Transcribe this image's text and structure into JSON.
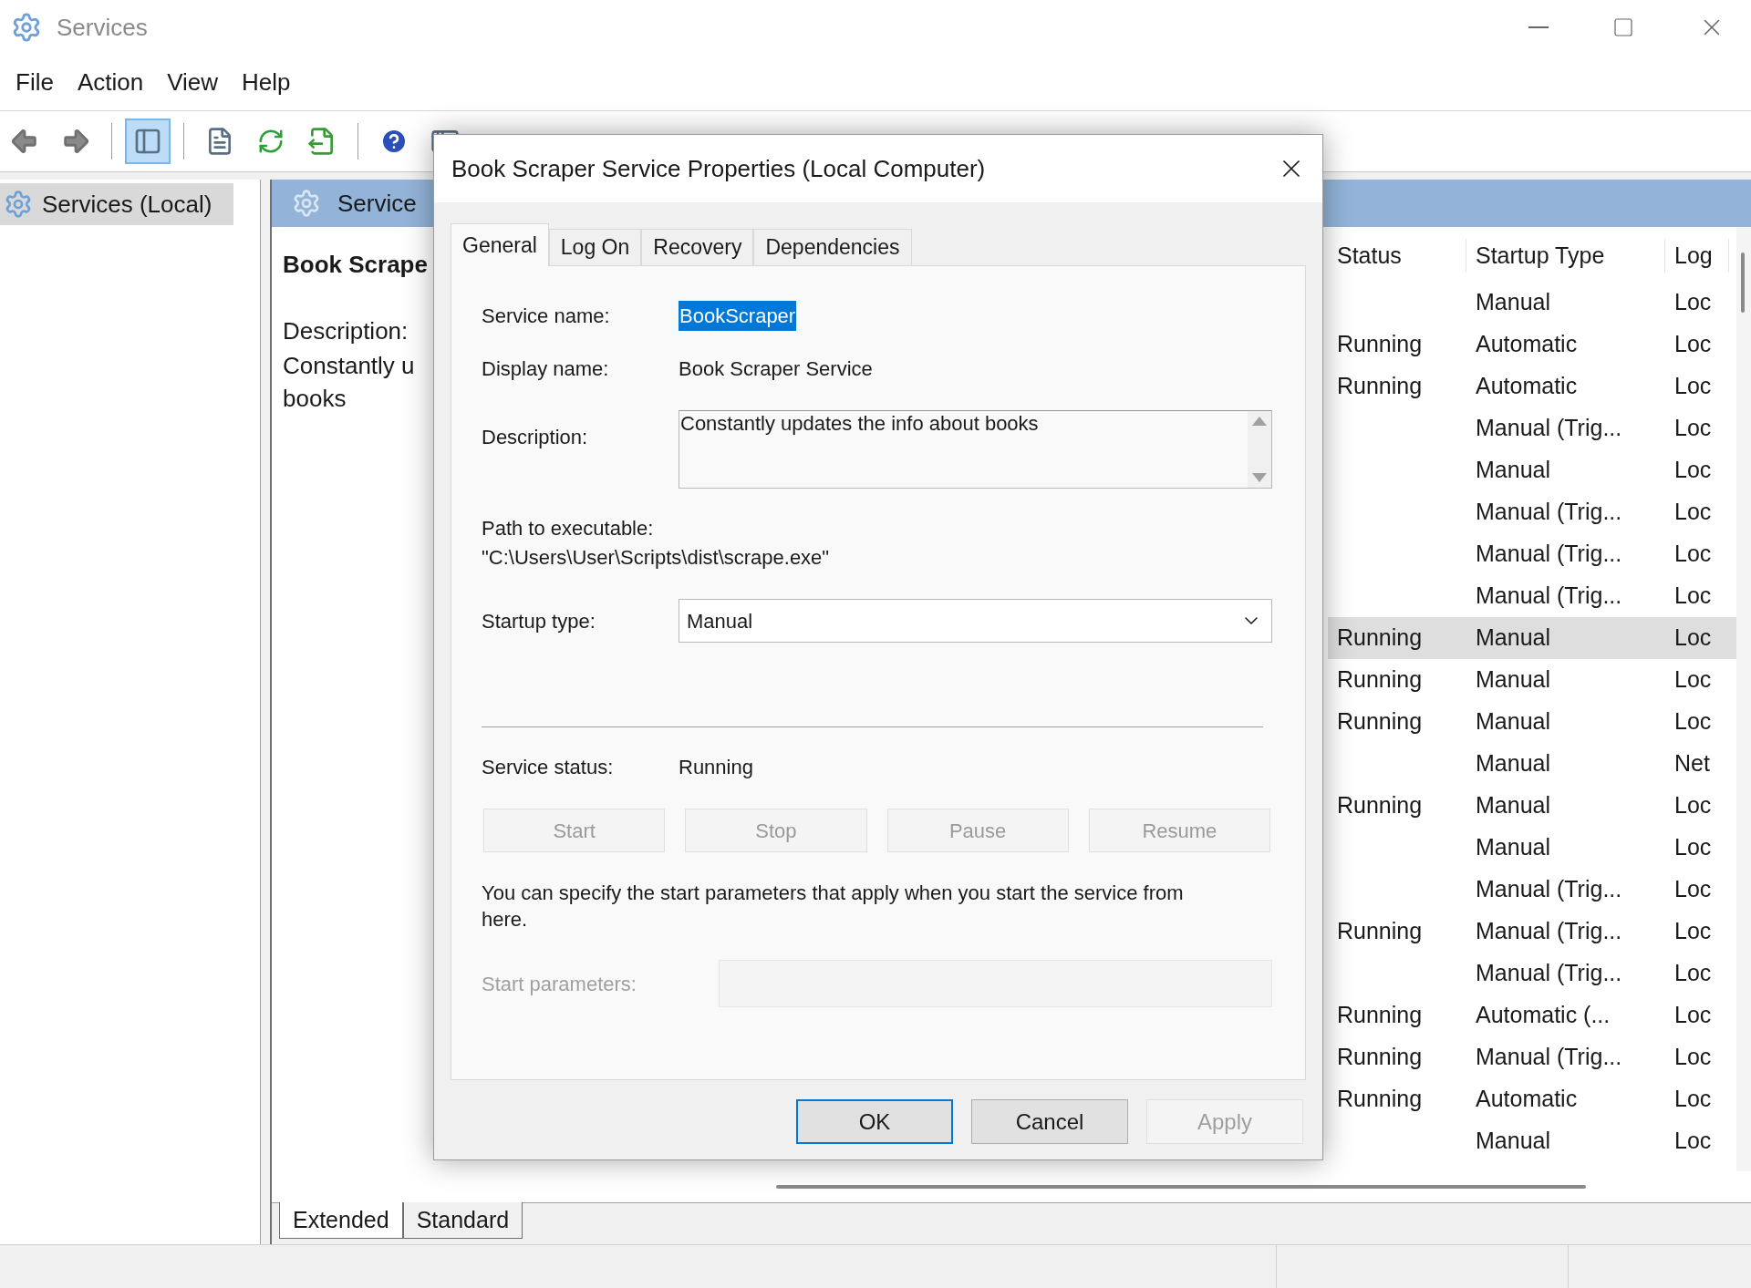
{
  "window": {
    "title": "Services"
  },
  "menu": [
    "File",
    "Action",
    "View",
    "Help"
  ],
  "toolbar": [
    [
      {
        "kind": "back",
        "on": false
      },
      {
        "kind": "forward",
        "on": false
      }
    ],
    [
      {
        "kind": "tree",
        "on": true
      }
    ],
    [
      {
        "kind": "properties",
        "on": false
      },
      {
        "kind": "refresh",
        "on": false
      },
      {
        "kind": "export",
        "on": false
      }
    ],
    [
      {
        "kind": "help",
        "on": false
      },
      {
        "kind": "view",
        "on": false
      }
    ]
  ],
  "tree": [
    {
      "label": "Services (Local)",
      "selected": true
    }
  ],
  "details": {
    "header": "Service",
    "title": "Book Scrape",
    "description_label": "Description:",
    "description_lines": [
      "Constantly u",
      "books"
    ]
  },
  "list": {
    "columns": [
      "Status",
      "Startup Type",
      "Log"
    ],
    "rows": [
      {
        "startup": "Manual",
        "log": "Loc",
        "selected": false
      },
      {
        "status": "Running",
        "startup": "Automatic",
        "log": "Loc",
        "selected": false
      },
      {
        "status": "Running",
        "startup": "Automatic",
        "log": "Loc",
        "selected": false
      },
      {
        "startup": "Manual (Trig...",
        "log": "Loc",
        "selected": false
      },
      {
        "startup": "Manual",
        "log": "Loc",
        "selected": false
      },
      {
        "startup": "Manual (Trig...",
        "log": "Loc",
        "selected": false
      },
      {
        "startup": "Manual (Trig...",
        "log": "Loc",
        "selected": false
      },
      {
        "startup": "Manual (Trig...",
        "log": "Loc",
        "selected": false
      },
      {
        "status": "Running",
        "startup": "Manual",
        "log": "Loc",
        "selected": true
      },
      {
        "status": "Running",
        "startup": "Manual",
        "log": "Loc",
        "selected": false
      },
      {
        "status": "Running",
        "startup": "Manual",
        "log": "Loc",
        "selected": false
      },
      {
        "startup": "Manual",
        "log": "Net",
        "selected": false
      },
      {
        "status": "Running",
        "startup": "Manual",
        "log": "Loc",
        "selected": false
      },
      {
        "startup": "Manual",
        "log": "Loc",
        "selected": false
      },
      {
        "startup": "Manual (Trig...",
        "log": "Loc",
        "selected": false
      },
      {
        "status": "Running",
        "startup": "Manual (Trig...",
        "log": "Loc",
        "selected": false
      },
      {
        "startup": "Manual (Trig...",
        "log": "Loc",
        "selected": false
      },
      {
        "status": "Running",
        "startup": "Automatic (...",
        "log": "Loc",
        "selected": false
      },
      {
        "status": "Running",
        "startup": "Manual (Trig...",
        "log": "Loc",
        "selected": false
      },
      {
        "status": "Running",
        "startup": "Automatic",
        "log": "Loc",
        "selected": false
      },
      {
        "startup": "Manual",
        "log": "Loc",
        "selected": false
      }
    ]
  },
  "view_tabs": [
    {
      "label": "Extended",
      "selected": true
    },
    {
      "label": "Standard",
      "selected": false
    }
  ],
  "dialog": {
    "title": "Book Scraper Service Properties (Local Computer)",
    "tabs": [
      {
        "label": "General",
        "selected": true
      },
      {
        "label": "Log On",
        "selected": false
      },
      {
        "label": "Recovery",
        "selected": false
      },
      {
        "label": "Dependencies",
        "selected": false
      }
    ],
    "service_name": {
      "label": "Service name:",
      "value": "BookScraper",
      "selected": true
    },
    "display_name": {
      "label": "Display name:",
      "value": "Book Scraper Service"
    },
    "description": {
      "label": "Description:",
      "value": "Constantly updates the info about books"
    },
    "path": {
      "label": "Path to executable:",
      "value": "\"C:\\Users\\User\\Scripts\\dist\\scrape.exe\""
    },
    "startup_type": {
      "label": "Startup type:",
      "value": "Manual"
    },
    "service_status": {
      "label": "Service status:",
      "value": "Running"
    },
    "actions": [
      {
        "label": "Start",
        "disabled": true
      },
      {
        "label": "Stop",
        "disabled": true
      },
      {
        "label": "Pause",
        "disabled": true
      },
      {
        "label": "Resume",
        "disabled": true
      }
    ],
    "hint": "You can specify the start parameters that apply when you start the service from here.",
    "start_parameters": {
      "label": "Start parameters:",
      "disabled": true
    },
    "buttons": [
      {
        "label": "OK",
        "default": true,
        "disabled": false
      },
      {
        "label": "Cancel",
        "default": false,
        "disabled": false
      },
      {
        "label": "Apply",
        "default": false,
        "disabled": true
      }
    ]
  }
}
